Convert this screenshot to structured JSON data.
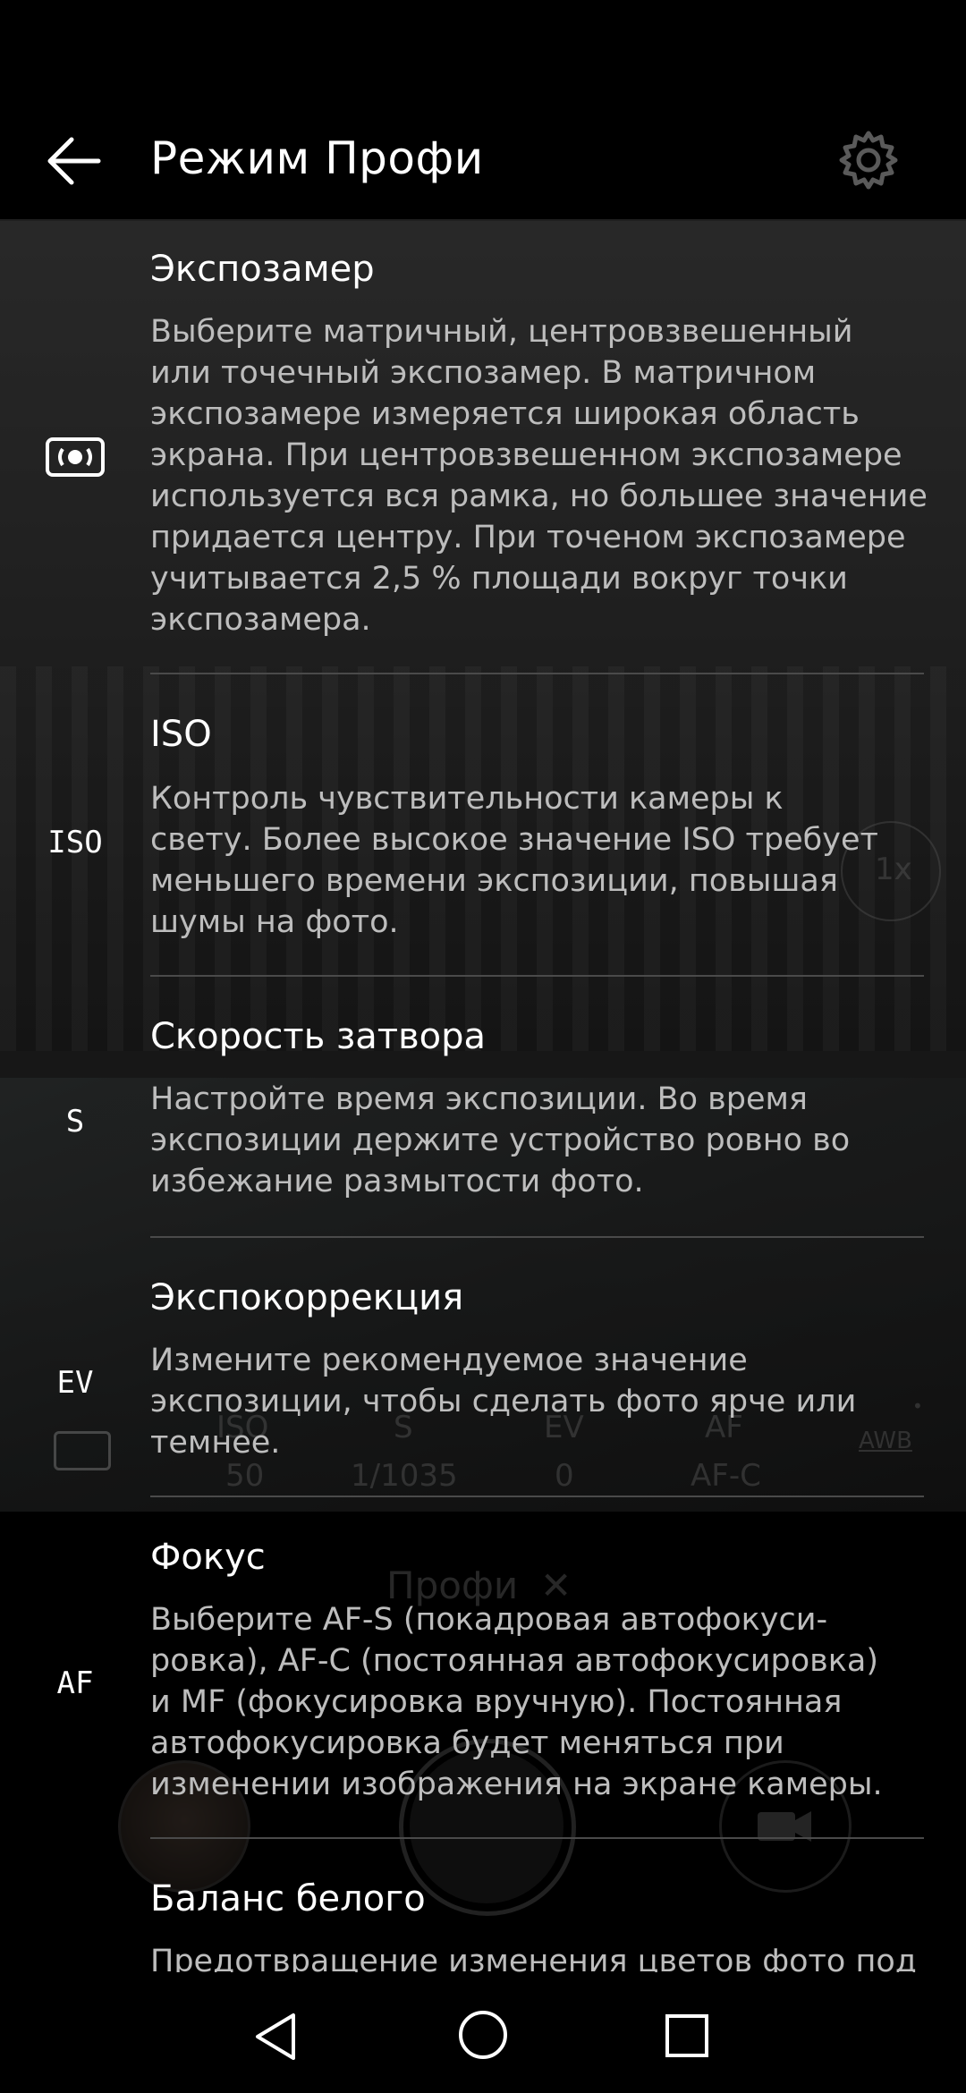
{
  "header": {
    "title": "Режим Профи",
    "back_icon": "arrow-left-icon",
    "settings_icon": "gear-icon"
  },
  "sections": [
    {
      "icon_type": "metering-icon",
      "icon_text": "",
      "title": "Экспозамер",
      "description": "Выберите матричный, центровзвешенный\nили точечный экспозамер. В матричном\nэкспозамере измеряется широкая область\nэкрана. При центровзвешенном экспозамере\nиспользуется вся рамка, но большее значение\nпридается центру. При точеном экспозамере\nучитывается 2,5 % площади вокруг точки\nэкспозамера."
    },
    {
      "icon_type": "text",
      "icon_text": "ISO",
      "title": "ISO",
      "description": "Контроль чувствительности камеры к\nсвету. Более высокое значение ISO требует\nменьшего времени экспозиции, повышая\nшумы на фото."
    },
    {
      "icon_type": "text",
      "icon_text": "S",
      "title": "Скорость затвора",
      "description": "Настройте время экспозиции. Во время\nэкспозиции держите устройство ровно во\nизбежание размытости фото."
    },
    {
      "icon_type": "text",
      "icon_text": "EV",
      "title": "Экспокоррекция",
      "description": "Измените рекомендуемое значение\nэкспозиции, чтобы сделать фото ярче или\nтемнее."
    },
    {
      "icon_type": "text",
      "icon_text": "AF",
      "title": "Фокус",
      "description": "Выберите AF-S (покадровая автофокуси-\nровка), AF-C (постоянная автофокусировка)\nи MF (фокусировка вручную). Постоянная\nавтофокусировка будет меняться при\nизменении изображения на экране камеры."
    },
    {
      "icon_type": "none",
      "icon_text": "",
      "title": "Баланс белого",
      "description": "Предотвращение изменения цветов фото под"
    }
  ],
  "camera_ghost": {
    "zoom": "1x",
    "params": [
      {
        "label": "ISO",
        "value": "50"
      },
      {
        "label": "S",
        "value": "1/1035"
      },
      {
        "label": "EV",
        "value": "0"
      },
      {
        "label": "AF",
        "value": "AF-C"
      },
      {
        "label": "AWB",
        "value": ""
      }
    ],
    "mode_label": "Профи",
    "mode_close": "✕"
  },
  "navbar": {
    "back_icon": "nav-back-icon",
    "home_icon": "nav-home-icon",
    "recent_icon": "nav-recent-icon"
  },
  "colors": {
    "background": "#000000",
    "text_primary": "#ffffff",
    "text_secondary": "#bdbdbd",
    "divider": "#4a4a4a"
  }
}
